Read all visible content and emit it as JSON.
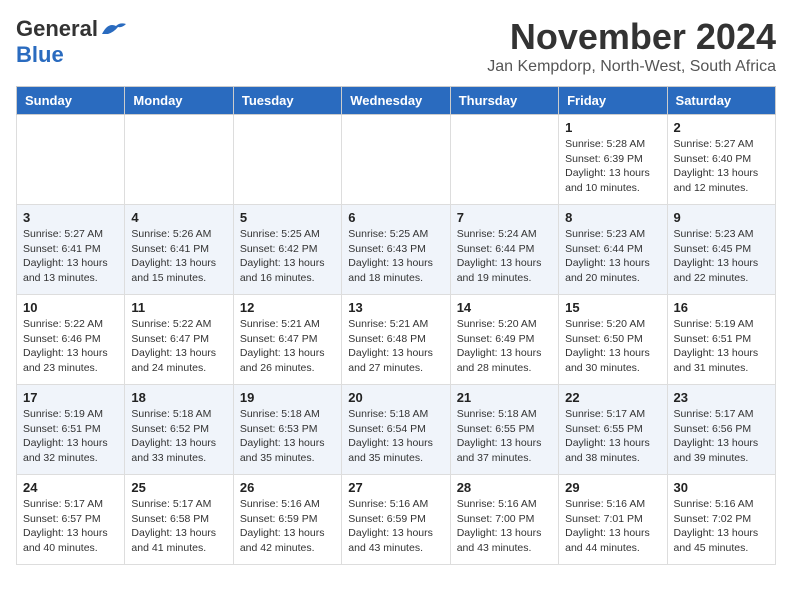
{
  "header": {
    "logo_general": "General",
    "logo_blue": "Blue",
    "month_title": "November 2024",
    "subtitle": "Jan Kempdorp, North-West, South Africa"
  },
  "weekdays": [
    "Sunday",
    "Monday",
    "Tuesday",
    "Wednesday",
    "Thursday",
    "Friday",
    "Saturday"
  ],
  "weeks": [
    [
      {
        "day": "",
        "info": ""
      },
      {
        "day": "",
        "info": ""
      },
      {
        "day": "",
        "info": ""
      },
      {
        "day": "",
        "info": ""
      },
      {
        "day": "",
        "info": ""
      },
      {
        "day": "1",
        "info": "Sunrise: 5:28 AM\nSunset: 6:39 PM\nDaylight: 13 hours\nand 10 minutes."
      },
      {
        "day": "2",
        "info": "Sunrise: 5:27 AM\nSunset: 6:40 PM\nDaylight: 13 hours\nand 12 minutes."
      }
    ],
    [
      {
        "day": "3",
        "info": "Sunrise: 5:27 AM\nSunset: 6:41 PM\nDaylight: 13 hours\nand 13 minutes."
      },
      {
        "day": "4",
        "info": "Sunrise: 5:26 AM\nSunset: 6:41 PM\nDaylight: 13 hours\nand 15 minutes."
      },
      {
        "day": "5",
        "info": "Sunrise: 5:25 AM\nSunset: 6:42 PM\nDaylight: 13 hours\nand 16 minutes."
      },
      {
        "day": "6",
        "info": "Sunrise: 5:25 AM\nSunset: 6:43 PM\nDaylight: 13 hours\nand 18 minutes."
      },
      {
        "day": "7",
        "info": "Sunrise: 5:24 AM\nSunset: 6:44 PM\nDaylight: 13 hours\nand 19 minutes."
      },
      {
        "day": "8",
        "info": "Sunrise: 5:23 AM\nSunset: 6:44 PM\nDaylight: 13 hours\nand 20 minutes."
      },
      {
        "day": "9",
        "info": "Sunrise: 5:23 AM\nSunset: 6:45 PM\nDaylight: 13 hours\nand 22 minutes."
      }
    ],
    [
      {
        "day": "10",
        "info": "Sunrise: 5:22 AM\nSunset: 6:46 PM\nDaylight: 13 hours\nand 23 minutes."
      },
      {
        "day": "11",
        "info": "Sunrise: 5:22 AM\nSunset: 6:47 PM\nDaylight: 13 hours\nand 24 minutes."
      },
      {
        "day": "12",
        "info": "Sunrise: 5:21 AM\nSunset: 6:47 PM\nDaylight: 13 hours\nand 26 minutes."
      },
      {
        "day": "13",
        "info": "Sunrise: 5:21 AM\nSunset: 6:48 PM\nDaylight: 13 hours\nand 27 minutes."
      },
      {
        "day": "14",
        "info": "Sunrise: 5:20 AM\nSunset: 6:49 PM\nDaylight: 13 hours\nand 28 minutes."
      },
      {
        "day": "15",
        "info": "Sunrise: 5:20 AM\nSunset: 6:50 PM\nDaylight: 13 hours\nand 30 minutes."
      },
      {
        "day": "16",
        "info": "Sunrise: 5:19 AM\nSunset: 6:51 PM\nDaylight: 13 hours\nand 31 minutes."
      }
    ],
    [
      {
        "day": "17",
        "info": "Sunrise: 5:19 AM\nSunset: 6:51 PM\nDaylight: 13 hours\nand 32 minutes."
      },
      {
        "day": "18",
        "info": "Sunrise: 5:18 AM\nSunset: 6:52 PM\nDaylight: 13 hours\nand 33 minutes."
      },
      {
        "day": "19",
        "info": "Sunrise: 5:18 AM\nSunset: 6:53 PM\nDaylight: 13 hours\nand 35 minutes."
      },
      {
        "day": "20",
        "info": "Sunrise: 5:18 AM\nSunset: 6:54 PM\nDaylight: 13 hours\nand 35 minutes."
      },
      {
        "day": "21",
        "info": "Sunrise: 5:18 AM\nSunset: 6:55 PM\nDaylight: 13 hours\nand 37 minutes."
      },
      {
        "day": "22",
        "info": "Sunrise: 5:17 AM\nSunset: 6:55 PM\nDaylight: 13 hours\nand 38 minutes."
      },
      {
        "day": "23",
        "info": "Sunrise: 5:17 AM\nSunset: 6:56 PM\nDaylight: 13 hours\nand 39 minutes."
      }
    ],
    [
      {
        "day": "24",
        "info": "Sunrise: 5:17 AM\nSunset: 6:57 PM\nDaylight: 13 hours\nand 40 minutes."
      },
      {
        "day": "25",
        "info": "Sunrise: 5:17 AM\nSunset: 6:58 PM\nDaylight: 13 hours\nand 41 minutes."
      },
      {
        "day": "26",
        "info": "Sunrise: 5:16 AM\nSunset: 6:59 PM\nDaylight: 13 hours\nand 42 minutes."
      },
      {
        "day": "27",
        "info": "Sunrise: 5:16 AM\nSunset: 6:59 PM\nDaylight: 13 hours\nand 43 minutes."
      },
      {
        "day": "28",
        "info": "Sunrise: 5:16 AM\nSunset: 7:00 PM\nDaylight: 13 hours\nand 43 minutes."
      },
      {
        "day": "29",
        "info": "Sunrise: 5:16 AM\nSunset: 7:01 PM\nDaylight: 13 hours\nand 44 minutes."
      },
      {
        "day": "30",
        "info": "Sunrise: 5:16 AM\nSunset: 7:02 PM\nDaylight: 13 hours\nand 45 minutes."
      }
    ]
  ]
}
